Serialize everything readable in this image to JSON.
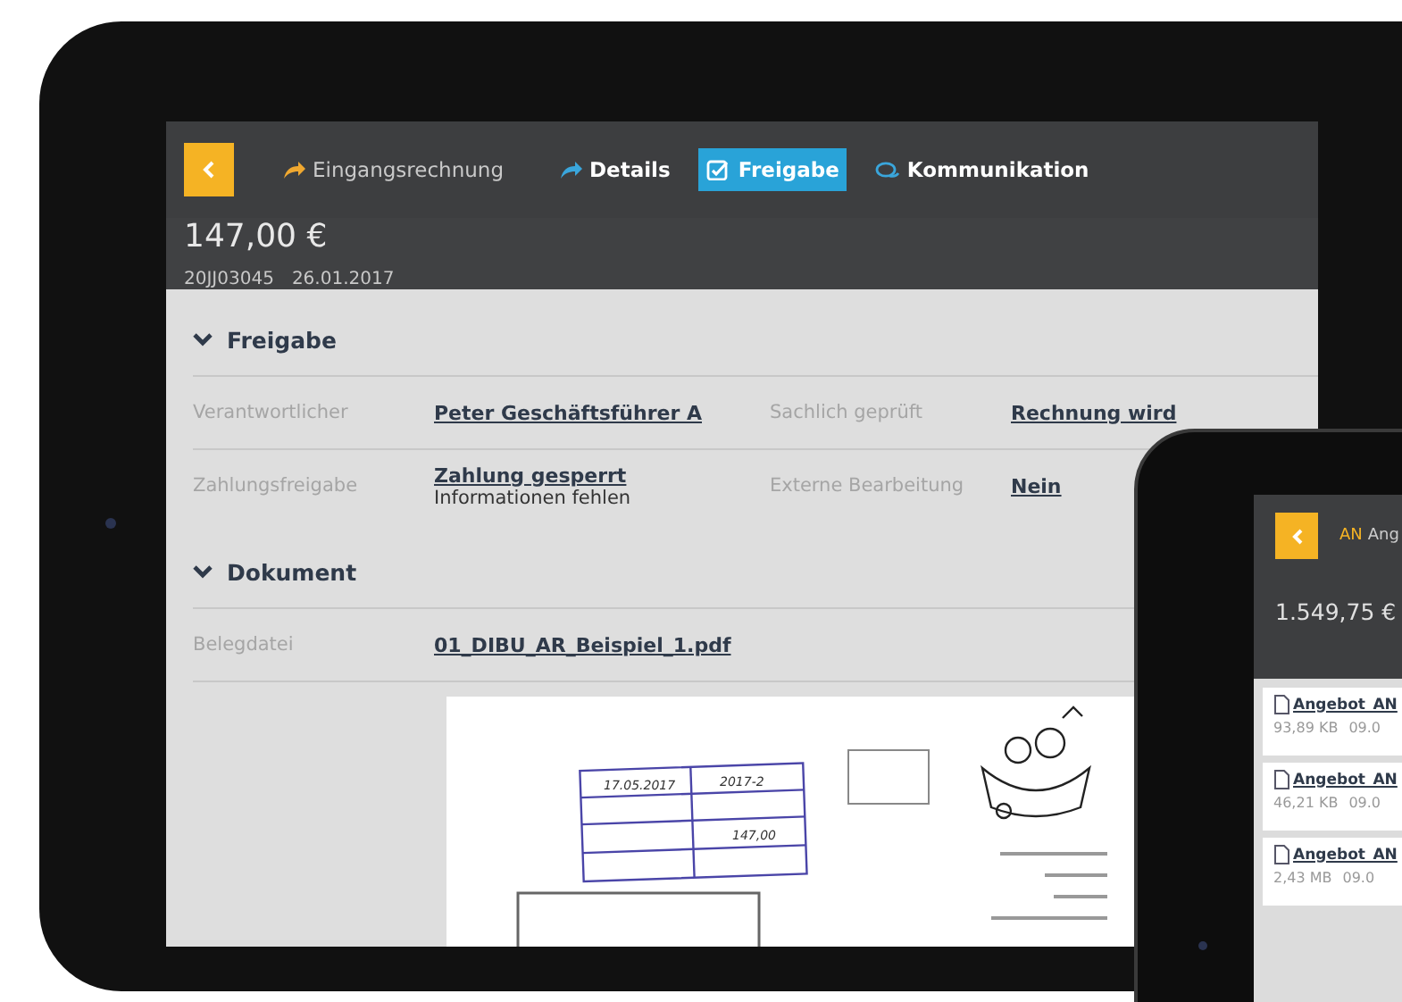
{
  "main_screen": {
    "nav": [
      {
        "kind": "breadcrumb",
        "label": "Eingangsrechnung",
        "selected": false
      },
      {
        "kind": "tab",
        "label": "Details",
        "selected": false
      },
      {
        "kind": "tab",
        "label": "Freigabe",
        "selected": true
      },
      {
        "kind": "tab",
        "label": "Kommunikation",
        "selected": false
      }
    ],
    "amount": "147,00 €",
    "number": "20JJ03045",
    "date": "26.01.2017",
    "sections": [
      {
        "title": "Freigabe",
        "expanded": true,
        "rows": [
          [
            {
              "label": "Verantwortlicher",
              "value": "Peter Geschäftsführer A"
            },
            {
              "label": "Sachlich geprüft",
              "value": "Rechnung wird"
            }
          ],
          [
            {
              "label": "Zahlungsfreigabe",
              "value": "Zahlung gesperrt",
              "note": "Informationen fehlen"
            },
            {
              "label": "Externe Bearbeitung",
              "value": "Nein"
            }
          ]
        ]
      },
      {
        "title": "Dokument",
        "expanded": true,
        "rows": [
          [
            {
              "label": "Belegdatei",
              "value": "01_DIBU_AR_Beispiel_1.pdf"
            }
          ]
        ]
      }
    ],
    "document": {
      "stamp_date": "17.05.2017",
      "stamp_number": "2017-2",
      "stamp_amount": "147,00"
    }
  },
  "second_screen": {
    "tag": "AN",
    "title": "Ang",
    "amount": "1.549,75 €",
    "files": [
      {
        "name": "Angebot_AN",
        "size": "93,89 KB",
        "date": "09.0"
      },
      {
        "name": "Angebot_AN",
        "size": "46,21 KB",
        "date": "09.0"
      },
      {
        "name": "Angebot_AN",
        "size": "2,43 MB",
        "date": "09.0"
      }
    ]
  }
}
